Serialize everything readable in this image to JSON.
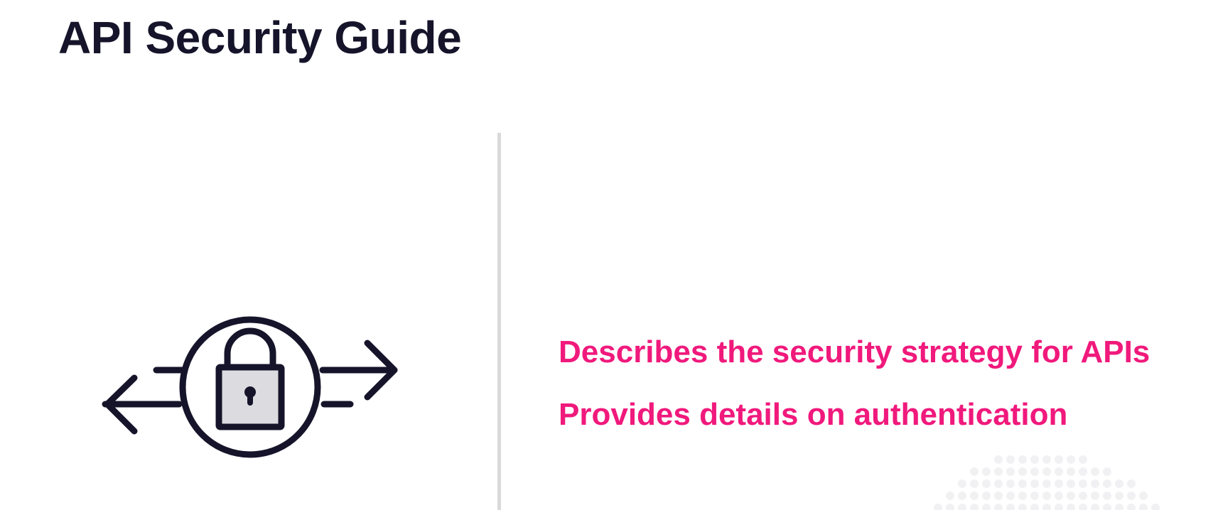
{
  "page": {
    "title": "API Security Guide"
  },
  "illustration": {
    "icon": "padlock-exchange-icon"
  },
  "bullets": [
    "Describes the security strategy for APIs",
    "Provides details on authentication"
  ],
  "colors": {
    "title": "#15142a",
    "accent": "#f0197c",
    "divider": "#d9d9d9",
    "icon_stroke": "#15142a",
    "icon_fill": "#dcdbe0",
    "dot_pattern": "#f1f1f3"
  }
}
